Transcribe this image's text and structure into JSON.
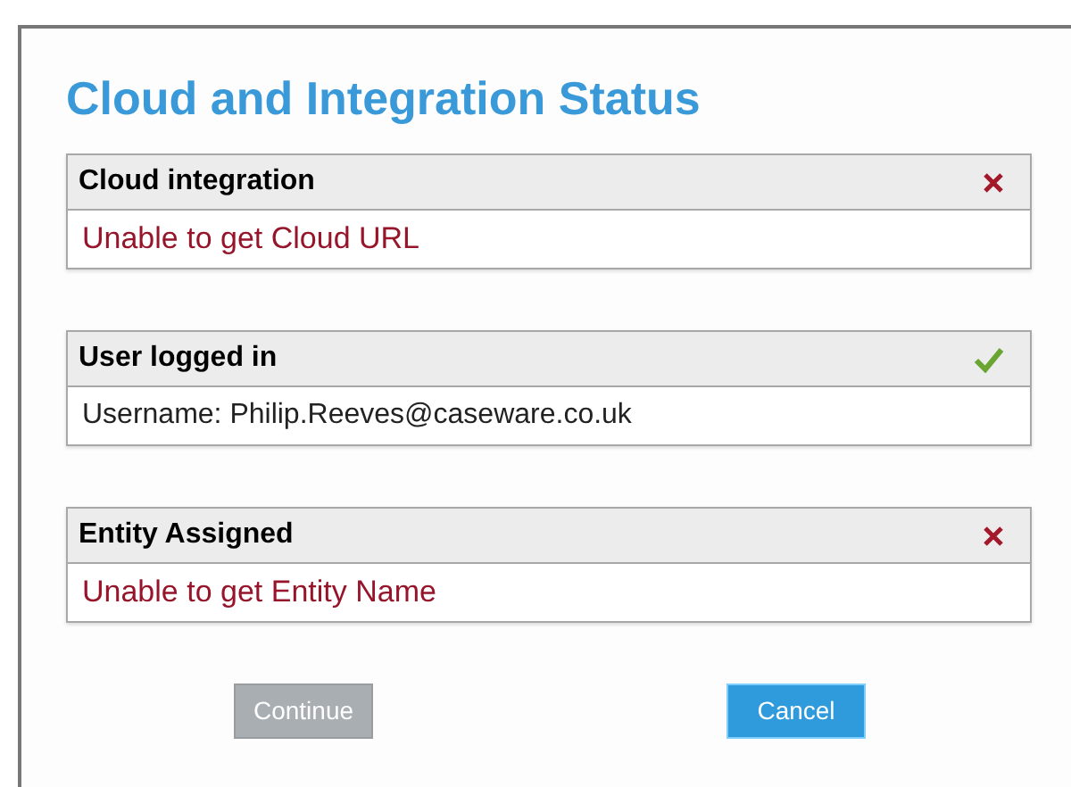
{
  "dialog": {
    "title": "Cloud and Integration Status"
  },
  "sections": [
    {
      "title": "Cloud integration",
      "ok": false,
      "message": "Unable to get Cloud URL"
    },
    {
      "title": "User logged in",
      "ok": true,
      "message": "Username: Philip.Reeves@caseware.co.uk"
    },
    {
      "title": "Entity Assigned",
      "ok": false,
      "message": "Unable to get Entity Name"
    }
  ],
  "buttons": [
    {
      "label": "Continue",
      "disabled": true,
      "kind": "secondary"
    },
    {
      "label": "Cancel",
      "disabled": false,
      "kind": "primary"
    }
  ]
}
